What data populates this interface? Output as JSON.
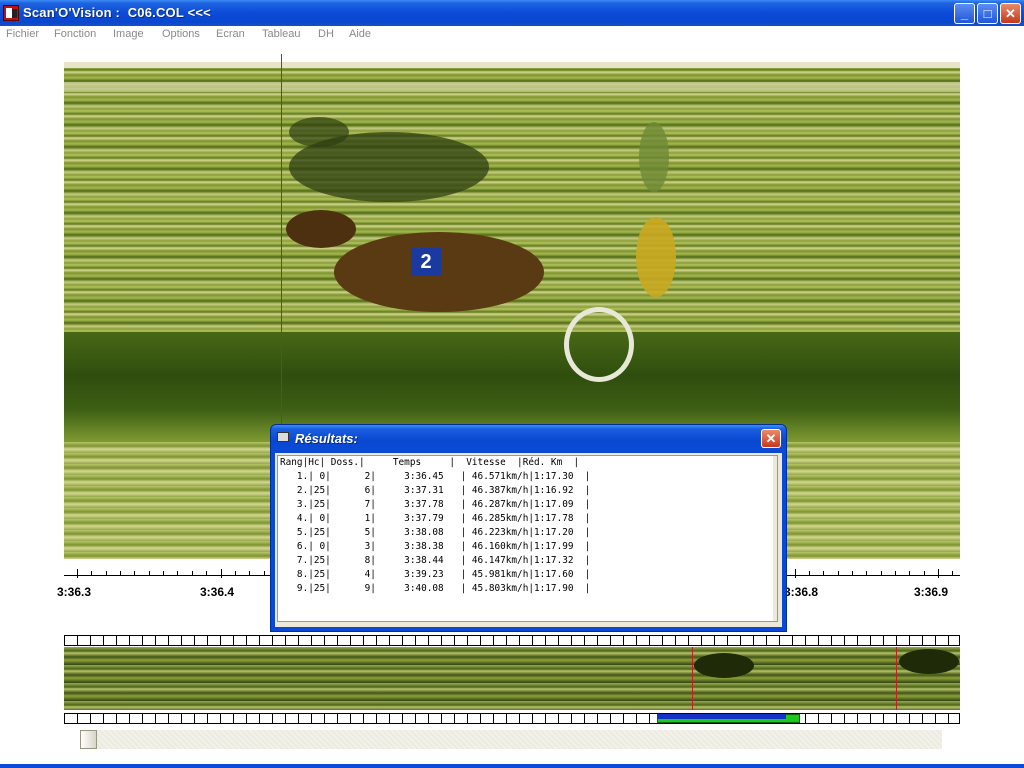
{
  "window": {
    "title": "Scan'O'Vision :  C06.COL <<<",
    "minimize": "_",
    "maximize": "□",
    "close": "✕"
  },
  "menu": [
    "Fichier",
    "Fonction",
    "Image",
    "Options",
    "Ecran",
    "Tableau",
    "DH",
    "Aide"
  ],
  "ruler": {
    "labels": [
      "3:36.3",
      "3:36.4",
      "3:36.8",
      "3:36.9"
    ]
  },
  "horse_number": "2",
  "dialog": {
    "title": "Résultats:",
    "close": "✕",
    "header": "Rang|Hc| Doss.|     Temps     |  Vitesse  |Réd. Km  |",
    "rows": [
      "   1.| 0|      2|     3:36.45   | 46.571km/h|1:17.30  |",
      "   2.|25|      6|     3:37.31   | 46.387km/h|1:16.92  |",
      "   3.|25|      7|     3:37.78   | 46.287km/h|1:17.09  |",
      "   4.| 0|      1|     3:37.79   | 46.285km/h|1:17.78  |",
      "   5.|25|      5|     3:38.08   | 46.223km/h|1:17.20  |",
      "   6.| 0|      3|     3:38.38   | 46.160km/h|1:17.99  |",
      "   7.|25|      8|     3:38.44   | 46.147km/h|1:17.32  |",
      "   8.|25|      4|     3:39.23   | 45.981km/h|1:17.60  |",
      "   9.|25|      9|     3:40.08   | 45.803km/h|1:17.90  |"
    ]
  },
  "colors": {
    "title_blue": "#0b4bd8",
    "cursor_red": "#c02020",
    "range_green": "#1ec81e",
    "range_blue": "#1432c8"
  }
}
